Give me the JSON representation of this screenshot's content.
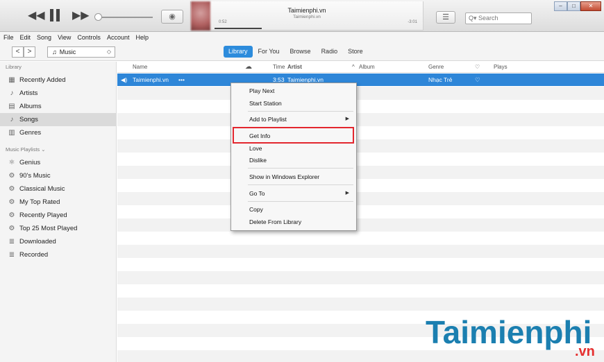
{
  "player": {
    "prev": "◀◀",
    "next": "▶▶",
    "airplay": "◉",
    "now_playing_title": "Taimienphi.vn",
    "now_playing_artist": "Taimienphi.vn",
    "elapsed": "0:52",
    "remaining": "-3:01",
    "list_icon": "☰",
    "search_placeholder": "Q▾ Search",
    "win_minimize": "–",
    "win_restore": "□",
    "win_close": "✕"
  },
  "menubar": [
    "File",
    "Edit",
    "Song",
    "View",
    "Controls",
    "Account",
    "Help"
  ],
  "nav": {
    "back": "<",
    "forward": ">",
    "media_label": "Music",
    "media_icon": "♫",
    "tabs": [
      "Library",
      "For You",
      "Browse",
      "Radio",
      "Store"
    ],
    "active_tab": "Library"
  },
  "sidebar": {
    "library_header": "Library",
    "library_items": [
      {
        "label": "Recently Added",
        "icon": "▦"
      },
      {
        "label": "Artists",
        "icon": "♪"
      },
      {
        "label": "Albums",
        "icon": "▤"
      },
      {
        "label": "Songs",
        "icon": "♪"
      },
      {
        "label": "Genres",
        "icon": "▥"
      }
    ],
    "playlists_header": "Music Playlists ⌄",
    "playlist_items": [
      {
        "label": "Genius",
        "icon": "⚛"
      },
      {
        "label": "90's Music",
        "icon": "⚙"
      },
      {
        "label": "Classical Music",
        "icon": "⚙"
      },
      {
        "label": "My Top Rated",
        "icon": "⚙"
      },
      {
        "label": "Recently Played",
        "icon": "⚙"
      },
      {
        "label": "Top 25 Most Played",
        "icon": "⚙"
      },
      {
        "label": "Downloaded",
        "icon": "≣"
      },
      {
        "label": "Recorded",
        "icon": "≣"
      }
    ]
  },
  "columns": {
    "name": "Name",
    "cloud": "☁",
    "time": "Time",
    "artist": "Artist",
    "album_sort": "^",
    "album": "Album",
    "genre": "Genre",
    "heart": "♡",
    "plays": "Plays"
  },
  "song_row": {
    "speaker": "◀)",
    "name": "Taimienphi.vn",
    "more": "•••",
    "time": "3:53",
    "artist": "Taimienphi.vn",
    "genre": "Nhạc Trẻ",
    "heart": "♡"
  },
  "context_menu": {
    "play_next": "Play Next",
    "start_station": "Start Station",
    "add_to_playlist": "Add to Playlist",
    "get_info": "Get Info",
    "love": "Love",
    "dislike": "Dislike",
    "show_in_explorer": "Show in Windows Explorer",
    "go_to": "Go To",
    "copy": "Copy",
    "delete_from_library": "Delete From Library",
    "submenu_arrow": "▶"
  },
  "watermark": {
    "main": "Taimienphi",
    "suffix": ".vn"
  },
  "colors": {
    "accent": "#2e86d8",
    "highlight_box": "#e3262e",
    "watermark_blue": "#1b7fb0",
    "watermark_red": "#e53030"
  }
}
